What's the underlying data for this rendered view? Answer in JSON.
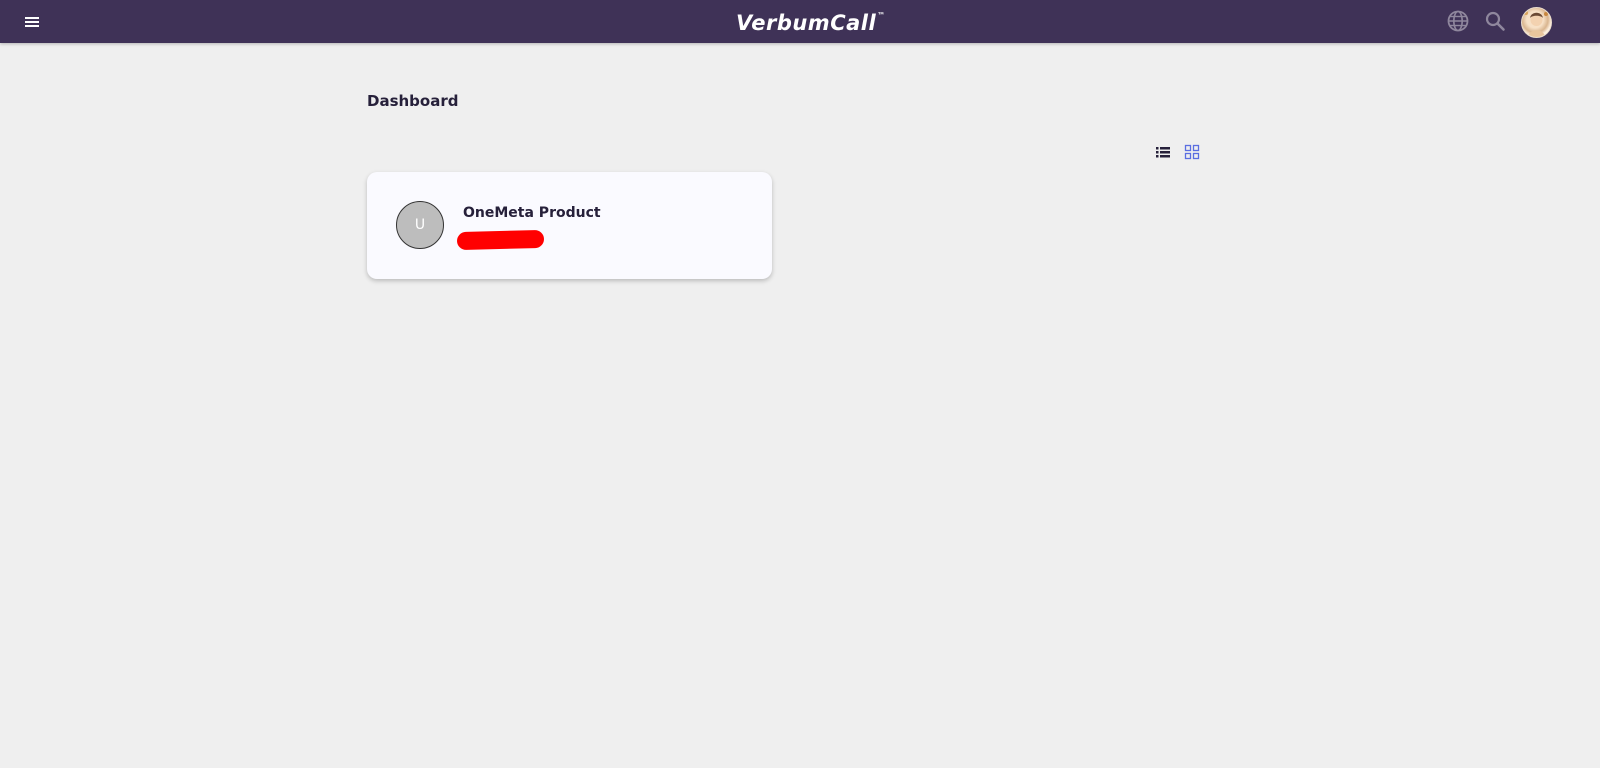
{
  "header": {
    "logo_text": "VerbumCall",
    "logo_mark": "™",
    "menu_icon": "menu-icon",
    "globe_icon": "globe-icon",
    "search_icon": "search-icon",
    "background_color": "#3f3257"
  },
  "main": {
    "page_title": "Dashboard",
    "view_toggle": {
      "list_icon": "list-view-icon",
      "grid_icon": "grid-view-icon",
      "active": "grid"
    },
    "cards": [
      {
        "avatar_initial": "U",
        "title": "OneMeta Product"
      }
    ]
  },
  "colors": {
    "page_background": "#efefef",
    "card_background": "#fafaff",
    "text_dark": "#26203a",
    "grid_active": "#5b6ee1",
    "redaction": "#ff0000"
  }
}
